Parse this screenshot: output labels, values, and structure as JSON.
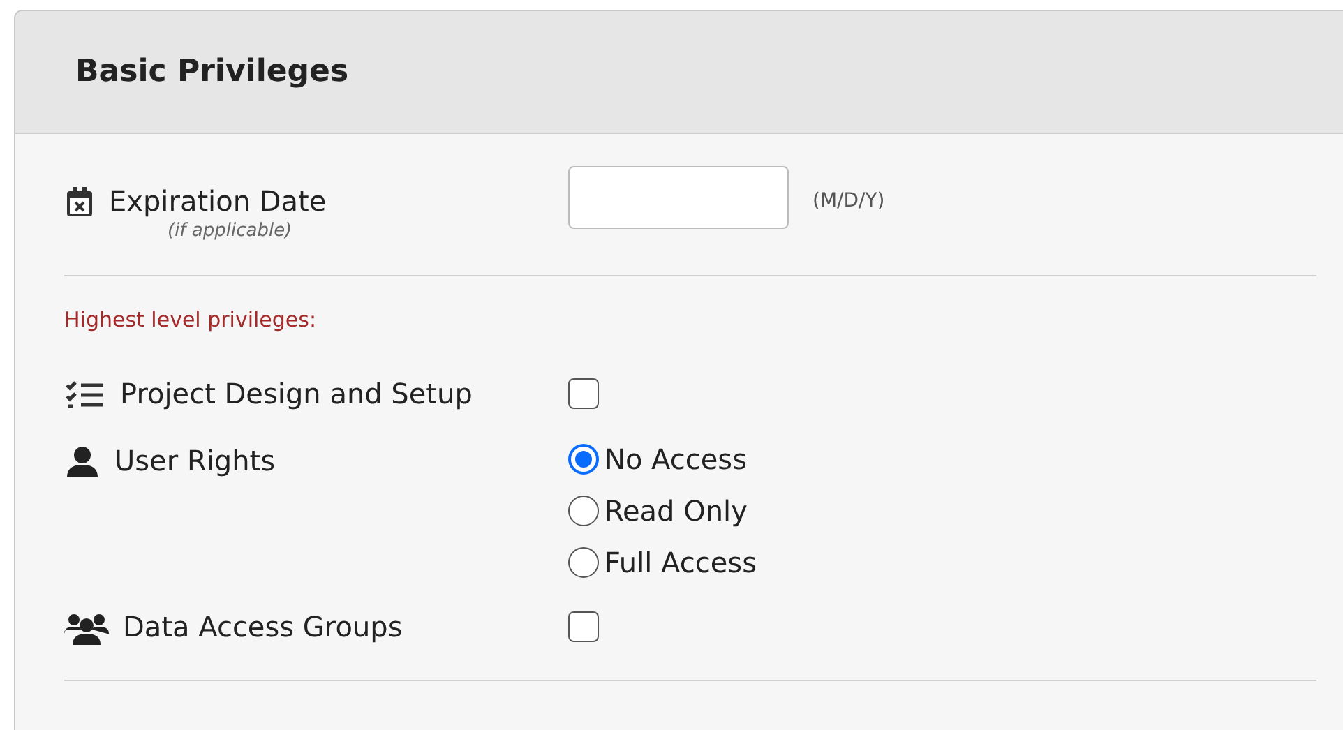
{
  "panel": {
    "title": "Basic Privileges"
  },
  "expiration": {
    "label": "Expiration Date",
    "note": "(if applicable)",
    "format": "(M/D/Y)"
  },
  "section_label": "Highest level privileges:",
  "privileges": [
    {
      "kind": "checkbox",
      "label": "Project Design and Setup",
      "checked": false
    },
    {
      "kind": "radio",
      "label": "User Rights",
      "options": [
        {
          "label": "No Access",
          "selected": true
        },
        {
          "label": "Read Only",
          "selected": false
        },
        {
          "label": "Full Access",
          "selected": false
        }
      ]
    },
    {
      "kind": "checkbox",
      "label": "Data Access Groups",
      "checked": false
    }
  ]
}
